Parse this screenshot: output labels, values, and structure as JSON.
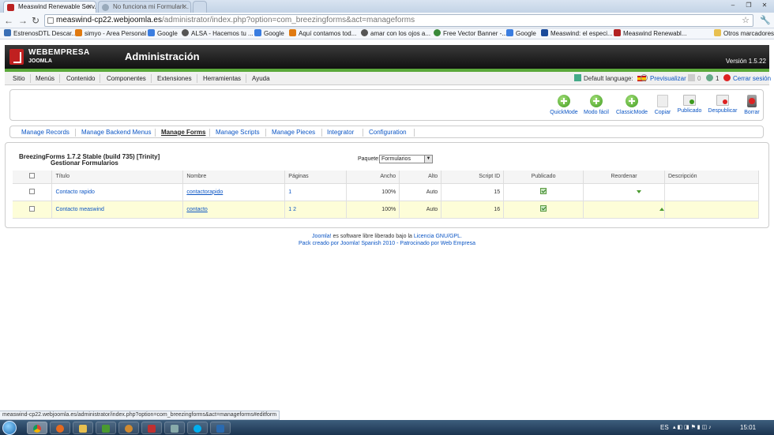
{
  "browser": {
    "tabs": [
      {
        "title": "Measwind Renewable Serv..."
      },
      {
        "title": "No funciona mi Formulari..."
      }
    ],
    "url_host": "measwind-cp22.webjoomla.es",
    "url_path": "/administrator/index.php?option=com_breezingforms&act=manageforms",
    "bookmarks": [
      {
        "label": "EstrenosDTL Descar...",
        "color": "#3a6fb5"
      },
      {
        "label": "simyo - Area Personal",
        "color": "#e07a10"
      },
      {
        "label": "Google",
        "color": "#3a7de0"
      },
      {
        "label": "ALSA - Hacemos tu ...",
        "color": "#555555"
      },
      {
        "label": "Google",
        "color": "#3a7de0"
      },
      {
        "label": "Aquí contamos tod...",
        "color": "#e07a10"
      },
      {
        "label": "amar con los ojos a...",
        "color": "#555555"
      },
      {
        "label": "Free Vector Banner -...",
        "color": "#3a8a3a"
      },
      {
        "label": "Google",
        "color": "#3a7de0"
      },
      {
        "label": "Measwind: el especi...",
        "color": "#1a4a9a"
      },
      {
        "label": "Measwind Renewabl...",
        "color": "#b22222"
      }
    ],
    "other_bookmarks": "Otros marcadores",
    "status_url": "measwind-cp22.webjoomla.es/administrator/index.php?option=com_breezingforms&act=manageforms#editform"
  },
  "header": {
    "brand_top": "WEBEMPRESA",
    "brand_bottom": "JOOMLA",
    "title": "Administración",
    "version": "Versión 1.5.22"
  },
  "menu": {
    "items": [
      "Sitio",
      "Menús",
      "Contenido",
      "Componentes",
      "Extensiones",
      "Herramientas",
      "Ayuda"
    ],
    "default_language": "Default language:",
    "preview": "Previsualizar",
    "messages_count": "0",
    "users_count": "1",
    "logout": "Cerrar sesión"
  },
  "toolbar": {
    "quickmode": "QuickMode",
    "easymode": "Modo fácil",
    "classicmode": "ClassicMode",
    "copy": "Copiar",
    "publish": "Publicado",
    "unpublish": "Despublicar",
    "delete": "Borrar"
  },
  "submenu": {
    "items": [
      "Manage Records",
      "Manage Backend Menus",
      "Manage Forms",
      "Manage Scripts",
      "Manage Pieces",
      "Integrator",
      "Configuration"
    ],
    "active": "Manage Forms"
  },
  "content": {
    "version_line": "BreezingForms 1.7.2 Stable (build 735) [Trinity]",
    "subtitle": "Gestionar Formularios",
    "package_label": "Paquete:",
    "package_value": "Formularios",
    "columns": [
      "Título",
      "Nombre",
      "Páginas",
      "Ancho",
      "Alto",
      "Script ID",
      "Publicado",
      "Reordenar",
      "Descripción"
    ],
    "rows": [
      {
        "title": "Contacto rapido",
        "name": "contactorapido",
        "pages": "1",
        "width": "100%",
        "height": "Auto",
        "script_id": "15"
      },
      {
        "title": "Contacto measwind",
        "name": "contacto",
        "pages": "1 2",
        "width": "100%",
        "height": "Auto",
        "script_id": "16"
      }
    ]
  },
  "footer": {
    "joomla": "Joomla!",
    "text1": " es software libre liberado bajo la ",
    "license": "Licencia GNU/GPL.",
    "line2": "Pack creado por Joomla! Spanish 2010 - Patrocinado por Web Empresa"
  },
  "taskbar": {
    "lang": "ES",
    "time": "15:01"
  }
}
